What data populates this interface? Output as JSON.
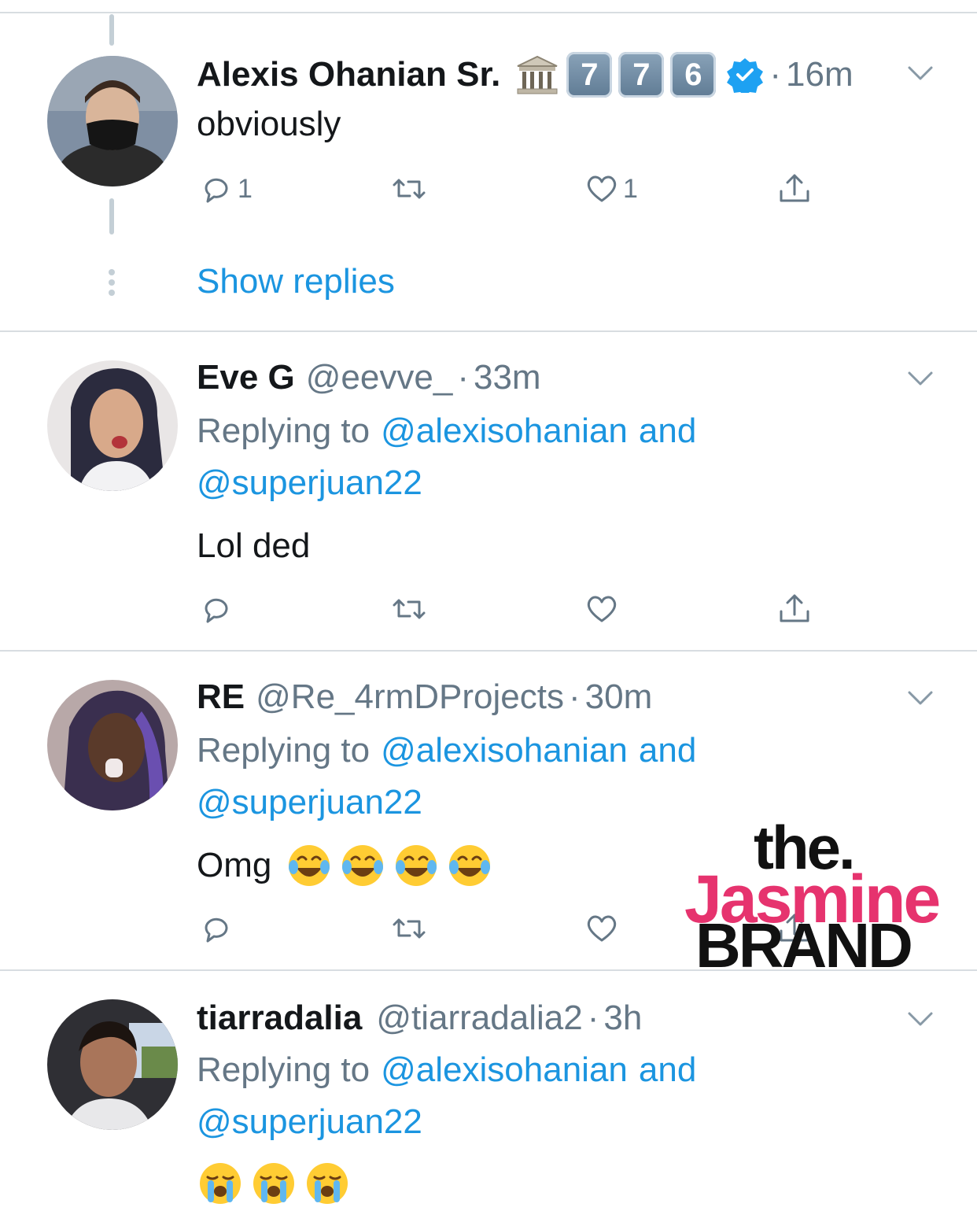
{
  "colors": {
    "link": "#1b95e0",
    "muted": "#657786",
    "text": "#14171a",
    "divider": "#d8dde1",
    "watermark_pink": "#e6336e"
  },
  "tweets": [
    {
      "name": "Alexis Ohanian Sr.",
      "badge_icons": [
        "classical-building-icon"
      ],
      "keycaps": [
        "7",
        "7",
        "6"
      ],
      "verified": true,
      "dot": "·",
      "time": "16m",
      "text": "obviously",
      "reply_count": "1",
      "like_count": "1",
      "show_replies": "Show replies"
    },
    {
      "name": "Eve G",
      "handle": "@eevve_",
      "dot": "·",
      "time": "33m",
      "replying_prefix": "Replying to",
      "replying_user1": "@alexisohanian",
      "replying_and": "and",
      "replying_user2": "@superjuan22",
      "text": "Lol ded"
    },
    {
      "name": "RE",
      "handle": "@Re_4rmDProjects",
      "dot": "·",
      "time": "30m",
      "replying_prefix": "Replying to",
      "replying_user1": "@alexisohanian",
      "replying_and": "and",
      "replying_user2": "@superjuan22",
      "text": "Omg",
      "emojis": [
        "face-with-tears-of-joy",
        "face-with-tears-of-joy",
        "face-with-tears-of-joy",
        "face-with-tears-of-joy"
      ]
    },
    {
      "name": "tiarradalia",
      "handle": "@tiarradalia2",
      "dot": "·",
      "time": "3h",
      "replying_prefix": "Replying to",
      "replying_user1": "@alexisohanian",
      "replying_and": "and",
      "replying_user2": "@superjuan22",
      "emojis": [
        "loudly-crying-face",
        "loudly-crying-face",
        "loudly-crying-face"
      ]
    }
  ],
  "watermark": {
    "line1": "the.",
    "line2": "Jasmine",
    "line3": "BRAND"
  }
}
